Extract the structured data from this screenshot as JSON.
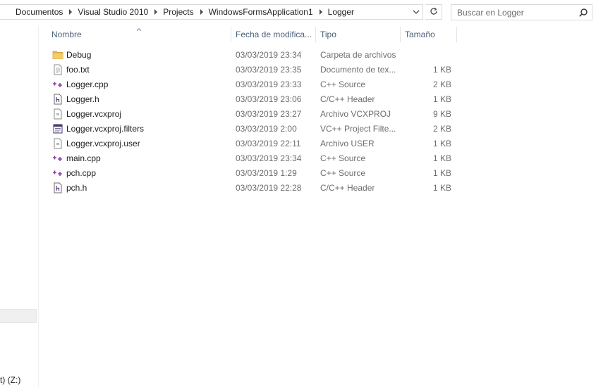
{
  "address_bar": {
    "breadcrumbs": [
      "Documentos",
      "Visual Studio 2010",
      "Projects",
      "WindowsFormsApplication1",
      "Logger"
    ]
  },
  "search": {
    "placeholder": "Buscar en Logger"
  },
  "nav": {
    "drive_label": "t) (Z:)"
  },
  "columns": {
    "name": "Nombre",
    "date": "Fecha de modifica...",
    "type": "Tipo",
    "size": "Tamaño"
  },
  "files": [
    {
      "icon": "folder-icon",
      "name": "Debug",
      "date": "03/03/2019 23:34",
      "type": "Carpeta de archivos",
      "size": ""
    },
    {
      "icon": "text-file-icon",
      "name": "foo.txt",
      "date": "03/03/2019 23:35",
      "type": "Documento de tex...",
      "size": "1 KB"
    },
    {
      "icon": "cpp-file-icon",
      "name": "Logger.cpp",
      "date": "03/03/2019 23:33",
      "type": "C++ Source",
      "size": "2 KB"
    },
    {
      "icon": "header-file-icon",
      "name": "Logger.h",
      "date": "03/03/2019 23:06",
      "type": "C/C++ Header",
      "size": "1 KB"
    },
    {
      "icon": "project-file-icon",
      "name": "Logger.vcxproj",
      "date": "03/03/2019 23:27",
      "type": "Archivo VCXPROJ",
      "size": "9 KB"
    },
    {
      "icon": "filters-file-icon",
      "name": "Logger.vcxproj.filters",
      "date": "03/03/2019 2:00",
      "type": "VC++ Project Filte...",
      "size": "2 KB"
    },
    {
      "icon": "project-file-icon",
      "name": "Logger.vcxproj.user",
      "date": "03/03/2019 22:11",
      "type": "Archivo USER",
      "size": "1 KB"
    },
    {
      "icon": "cpp-file-icon",
      "name": "main.cpp",
      "date": "03/03/2019 23:34",
      "type": "C++ Source",
      "size": "1 KB"
    },
    {
      "icon": "cpp-file-icon",
      "name": "pch.cpp",
      "date": "03/03/2019 1:29",
      "type": "C++ Source",
      "size": "1 KB"
    },
    {
      "icon": "header-file-icon",
      "name": "pch.h",
      "date": "03/03/2019 22:28",
      "type": "C/C++ Header",
      "size": "1 KB"
    }
  ],
  "colors": {
    "header_text": "#4c607a",
    "detail_text": "#6d6d6d",
    "folder": "#e8b84a",
    "cpp_accent": "#8b3fa8"
  }
}
